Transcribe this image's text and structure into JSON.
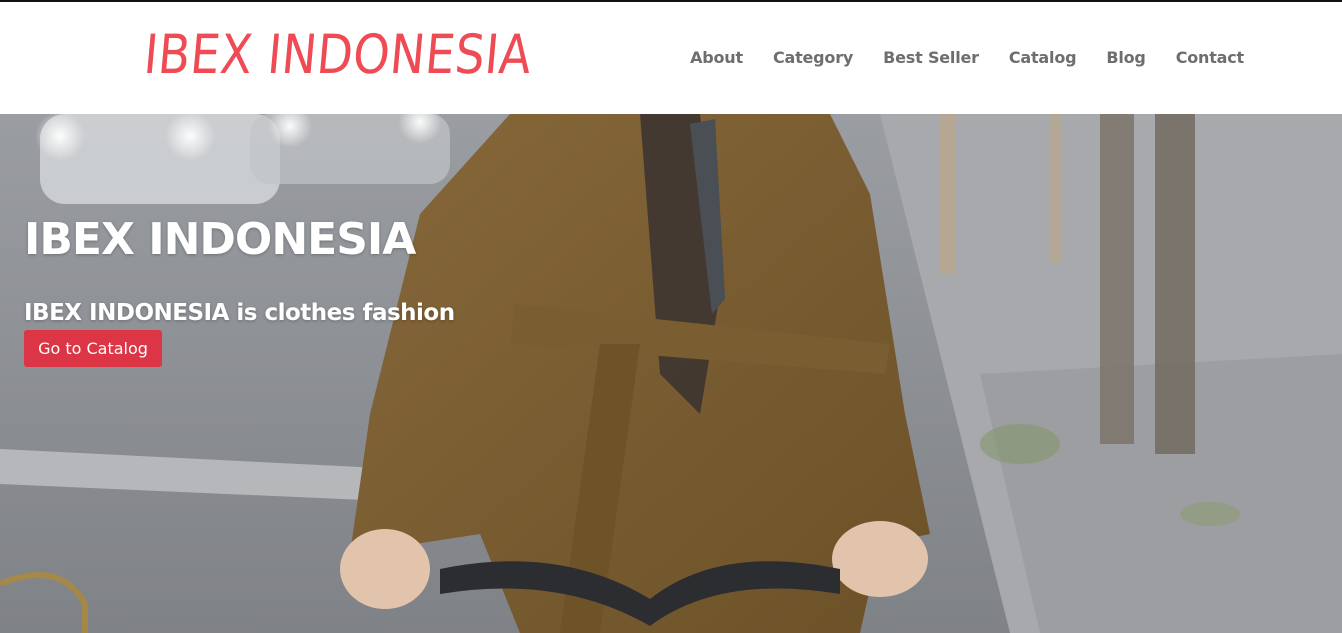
{
  "header": {
    "logo_text": "IBEX INDONESIA",
    "nav": [
      {
        "label": "About"
      },
      {
        "label": "Category"
      },
      {
        "label": "Best Seller"
      },
      {
        "label": "Catalog"
      },
      {
        "label": "Blog"
      },
      {
        "label": "Contact"
      }
    ]
  },
  "hero": {
    "title": "IBEX INDONESIA",
    "subtitle": "IBEX INDONESIA is clothes fashion",
    "button_label": "Go to Catalog",
    "image_subject": "person-in-brown-trench-coat-riding-bicycle"
  },
  "colors": {
    "logo": "#ee4b55",
    "nav_text": "#6e6e6e",
    "button_bg": "#dc3545",
    "hero_text": "#ffffff"
  }
}
